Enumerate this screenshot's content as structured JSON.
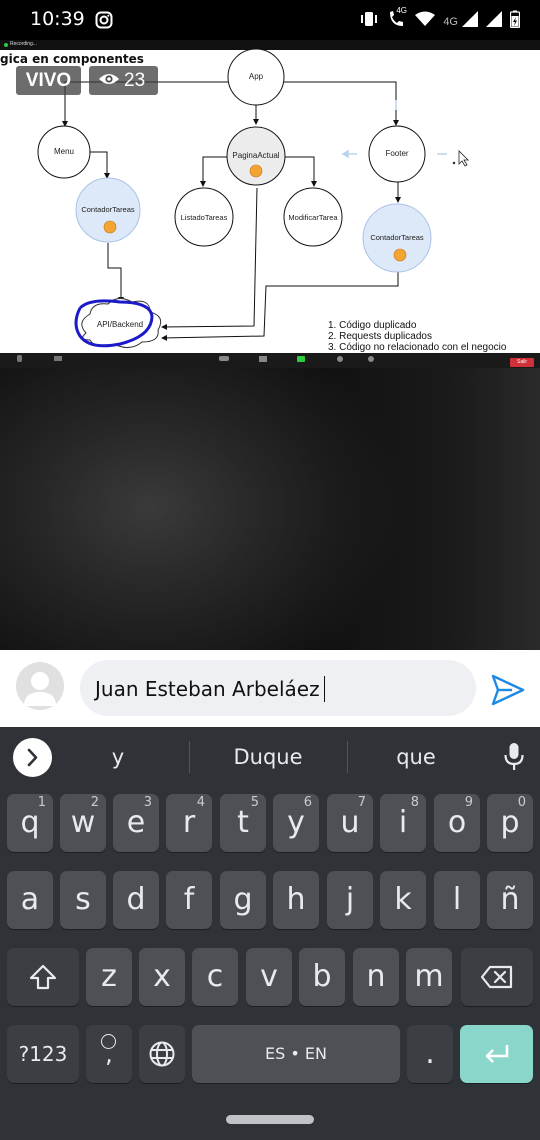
{
  "status_bar": {
    "time": "10:39",
    "network_label_1": "4G",
    "network_label_2": "4G",
    "icons": [
      "instagram-icon",
      "vibrate-icon",
      "wifi-calling-icon",
      "wifi-icon",
      "signal-icon",
      "signal-icon",
      "battery-charging-icon"
    ]
  },
  "stream": {
    "recording_label": "Recording...",
    "slide_title": "gica en componentes",
    "live_badge": "VIVO",
    "viewer_count": "23",
    "diagram": {
      "nodes": {
        "app": "App",
        "menu": "Menu",
        "pagina_actual": "PaginaActual",
        "footer": "Footer",
        "contador_tareas_left": "ContadorTareas",
        "listado_tareas": "ListadoTareas",
        "modificar_tarea": "ModificarTarea",
        "contador_tareas_right": "ContadorTareas",
        "api_backend": "API/Backend"
      }
    },
    "notes": [
      "1. Código duplicado",
      "2. Requests duplicados",
      "3. Código no relacionado con el negocio"
    ],
    "toolbar": {
      "leave_label": "Salir"
    }
  },
  "chat": {
    "input_value": "Juan Esteban Arbeláez",
    "send_icon": "send-icon",
    "avatar_icon": "user-avatar-icon"
  },
  "keyboard": {
    "suggestions": [
      "y",
      "Duque",
      "que"
    ],
    "row1": [
      {
        "label": "q",
        "sup": "1"
      },
      {
        "label": "w",
        "sup": "2"
      },
      {
        "label": "e",
        "sup": "3"
      },
      {
        "label": "r",
        "sup": "4"
      },
      {
        "label": "t",
        "sup": "5"
      },
      {
        "label": "y",
        "sup": "6"
      },
      {
        "label": "u",
        "sup": "7"
      },
      {
        "label": "i",
        "sup": "8"
      },
      {
        "label": "o",
        "sup": "9"
      },
      {
        "label": "p",
        "sup": "0"
      }
    ],
    "row2": [
      "a",
      "s",
      "d",
      "f",
      "g",
      "h",
      "j",
      "k",
      "l",
      "ñ"
    ],
    "row3": [
      "z",
      "x",
      "c",
      "v",
      "b",
      "n",
      "m"
    ],
    "symbols_key": "?123",
    "comma_key": ",",
    "space_key": "ES • EN",
    "period_key": ".",
    "colors": {
      "background": "#2f3237",
      "key": "#4d5156",
      "enter": "#8ad6cb",
      "send": "#1e88e5"
    }
  }
}
